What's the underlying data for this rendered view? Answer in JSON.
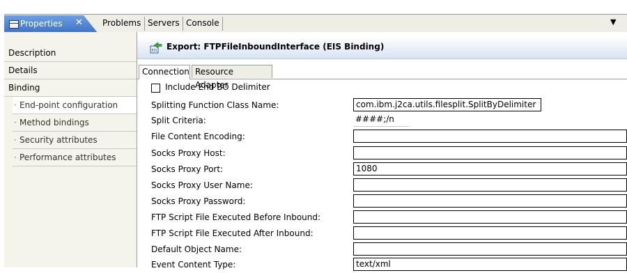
{
  "tabs": {
    "active": "Properties",
    "close": "✕",
    "others": [
      "Problems",
      "Servers",
      "Console"
    ],
    "menu": "▼"
  },
  "nav": {
    "items": [
      "Description",
      "Details",
      "Binding"
    ],
    "subitems": [
      "End-point configuration",
      "Method bindings",
      "Security attributes",
      "Performance attributes"
    ]
  },
  "header": {
    "title": "Export: FTPFileInboundInterface (EIS Binding)"
  },
  "subtabs": [
    "Connection",
    "Resource Adapter"
  ],
  "form": {
    "checkbox_label": "Include End BO Delimiter",
    "fields": [
      {
        "label": "Splitting Function Class Name:",
        "value": "com.ibm.j2ca.utils.filesplit.SplitByDelimiter"
      },
      {
        "label": "Split Criteria:",
        "value": "####;/n"
      },
      {
        "label": "File Content Encoding:",
        "value": ""
      },
      {
        "label": "Socks Proxy Host:",
        "value": ""
      },
      {
        "label": "Socks Proxy Port:",
        "value": "1080"
      },
      {
        "label": "Socks Proxy User Name:",
        "value": ""
      },
      {
        "label": "Socks Proxy Password:",
        "value": ""
      },
      {
        "label": "FTP Script File Executed Before Inbound:",
        "value": ""
      },
      {
        "label": "FTP Script File Executed After Inbound:",
        "value": ""
      },
      {
        "label": "Default Object Name:",
        "value": ""
      },
      {
        "label": "Event Content Type:",
        "value": "text/xml"
      }
    ]
  }
}
